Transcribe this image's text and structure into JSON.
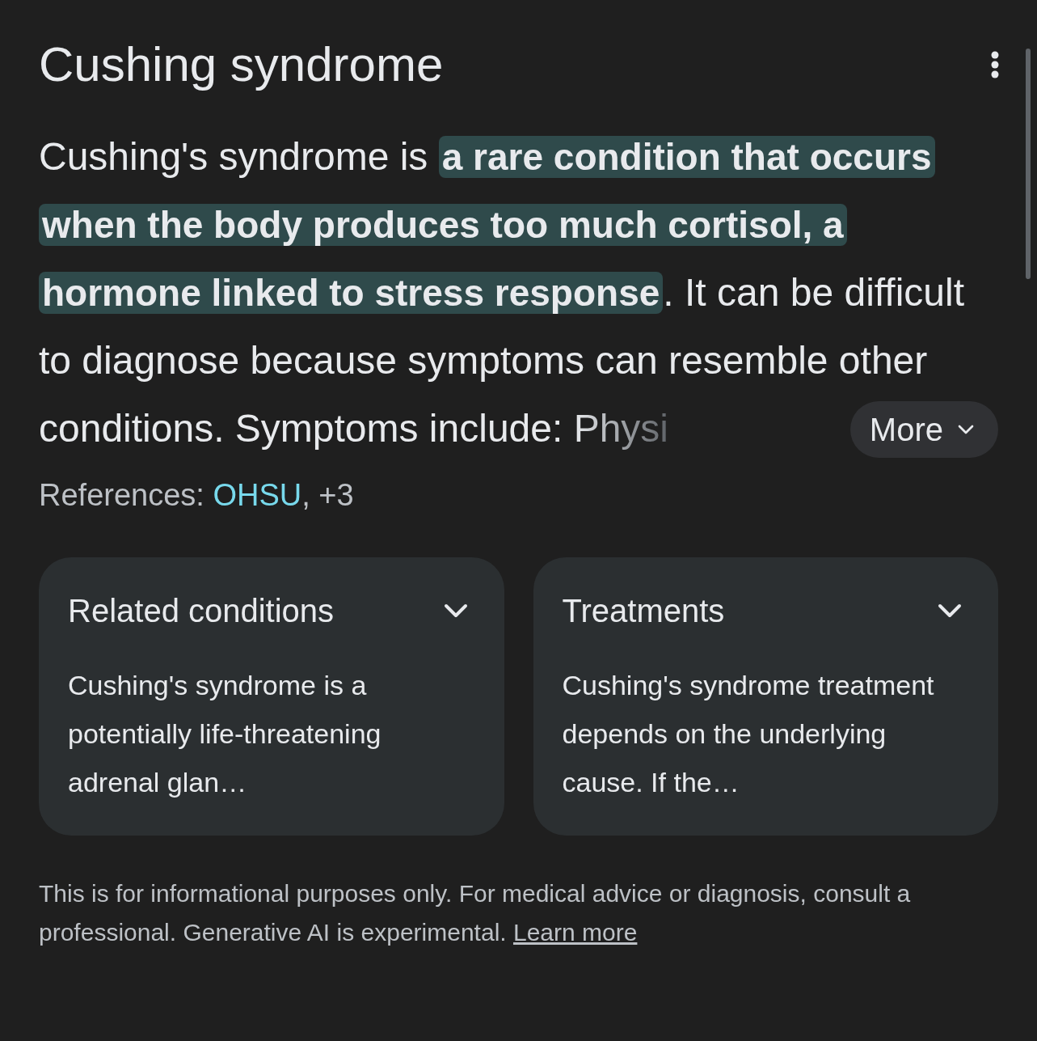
{
  "title": "Cushing syndrome",
  "summary": {
    "segments": [
      {
        "kind": "plain",
        "text": "Cushing's syndrome is "
      },
      {
        "kind": "highlight",
        "text": "a rare condition that occurs when the body produces too much cortisol, a hormone linked to stress response"
      },
      {
        "kind": "plain",
        "text": ". It can be difficult to diagnose because symptoms can resemble other conditions. Symptoms include: "
      },
      {
        "kind": "faded",
        "text": "Physi"
      }
    ],
    "more_button": "More"
  },
  "references": {
    "label": "References:",
    "link": "OHSU",
    "extra": ", +3"
  },
  "cards": [
    {
      "title": "Related conditions",
      "expanded": false,
      "text": "Cushing's syndrome is a potentially life-threatening adrenal glan…"
    },
    {
      "title": "Treatments",
      "expanded": false,
      "text": "Cushing's syndrome treatment depends on the underlying cause. If the…"
    }
  ],
  "disclaimer": {
    "text": "This is for informational purposes only. For medical advice or diagnosis, consult a professional. Generative AI is experimental.",
    "link": "Learn more"
  }
}
